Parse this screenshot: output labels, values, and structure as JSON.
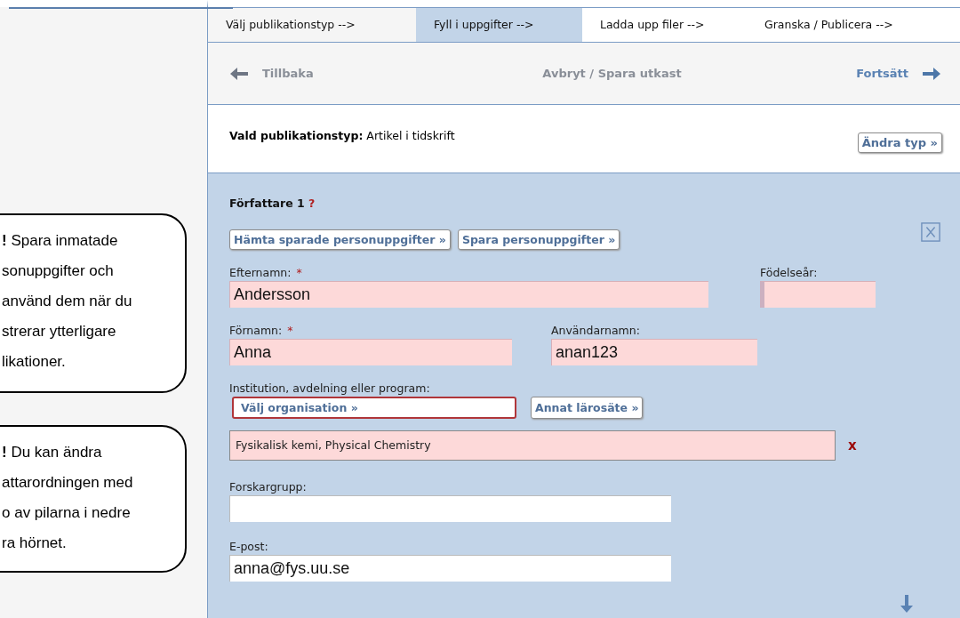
{
  "callouts": [
    {
      "lines": [
        "**!** Spara inmatade",
        "sonuppgifter och",
        "använd dem när du",
        "strerar ytterligare",
        "likationer."
      ]
    },
    {
      "lines": [
        "**!** Du kan ändra",
        "attarordningen med",
        "o av pilarna i nedre",
        "ra hörnet."
      ]
    }
  ],
  "tabs": [
    {
      "label": "Välj publikationstyp -->",
      "selected": false
    },
    {
      "label": "Fyll i uppgifter -->",
      "selected": true
    },
    {
      "label": "Ladda upp filer -->",
      "selected": false
    },
    {
      "label": "Granska / Publicera -->",
      "selected": false
    }
  ],
  "nav": {
    "back": "Tillbaka",
    "middle": "Avbryt / Spara utkast",
    "forward": "Fortsätt"
  },
  "publication_type": {
    "label": "Vald publikationstyp:",
    "value": "Artikel i tidskrift",
    "change_button": "Ändra typ »"
  },
  "author": {
    "heading": "Författare 1",
    "help": "?",
    "buttons": [
      "Hämta sparade personuppgifter »",
      "Spara personuppgifter »"
    ],
    "surname": {
      "label": "Efternamn:",
      "required_mark": "*",
      "value": "Andersson",
      "highlighted": true
    },
    "birth_year": {
      "label": "Födelseår:",
      "highlighted": true
    },
    "first_name": {
      "label": "Förnamn:",
      "required_mark": "*",
      "value": "Anna",
      "highlighted": true
    },
    "username": {
      "label": "Användarnamn:",
      "value": "anan123",
      "highlighted": true
    },
    "institution": {
      "label": "Institution, avdelning eller program:",
      "choose_button": "Välj organisation »",
      "other_button": "Annat lärosäte »",
      "selected": "Fysikalisk kemi, Physical Chemistry",
      "remove": "x"
    },
    "research_group": {
      "label": "Forskargrupp:",
      "highlighted": false
    },
    "email": {
      "label": "E-post:",
      "value": "anna@fys.uu.se",
      "highlighted": false
    }
  }
}
